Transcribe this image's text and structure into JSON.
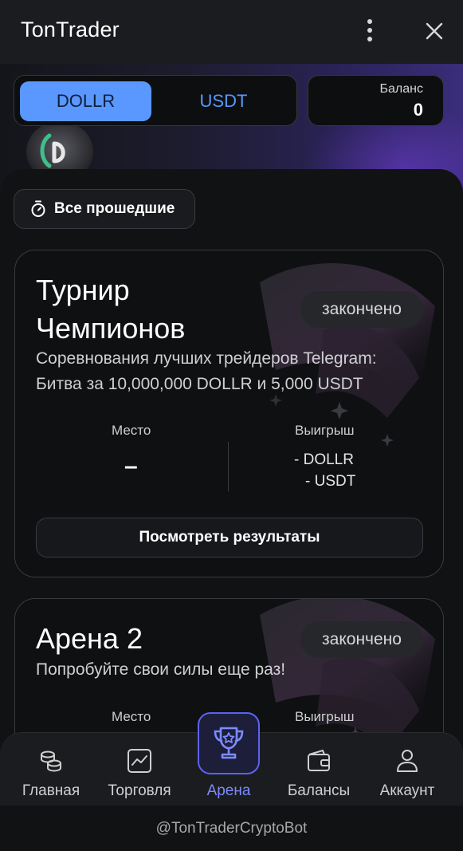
{
  "app": {
    "title": "TonTrader"
  },
  "currency_toggle": {
    "options": [
      "DOLLR",
      "USDT"
    ],
    "selected": "DOLLR"
  },
  "balance": {
    "label": "Баланс",
    "value": "0"
  },
  "filter": {
    "label": "Все прошедшие",
    "icon": "stopwatch-icon"
  },
  "tournaments": [
    {
      "title_line1": "Турнир",
      "title_line2": "Чемпионов",
      "status": "закончено",
      "description_line1": "Соревнования лучших трейдеров Telegram:",
      "description_line2": "Битва за 10,000,000 DOLLR и 5,000 USDT",
      "place_label": "Место",
      "place_value": "–",
      "prize_label": "Выигрыш",
      "prize_line1": "- DOLLR",
      "prize_line2": "- USDT",
      "button_label": "Посмотреть результаты"
    },
    {
      "title_line1": "Арена 2",
      "status": "закончено",
      "description_line1": "Попробуйте свои силы еще раз!",
      "place_label": "Место",
      "prize_label": "Выигрыш"
    }
  ],
  "nav": {
    "items": [
      {
        "label": "Главная",
        "icon": "coins-icon"
      },
      {
        "label": "Торговля",
        "icon": "chart-icon"
      },
      {
        "label": "Арена",
        "icon": "trophy-icon",
        "active": true
      },
      {
        "label": "Балансы",
        "icon": "wallet-icon"
      },
      {
        "label": "Аккаунт",
        "icon": "user-icon"
      }
    ]
  },
  "footer": {
    "bot_handle": "@TonTraderCryptoBot"
  },
  "colors": {
    "accent": "#5a97ff",
    "nav_active": "#7d8bff",
    "background": "#111214"
  }
}
